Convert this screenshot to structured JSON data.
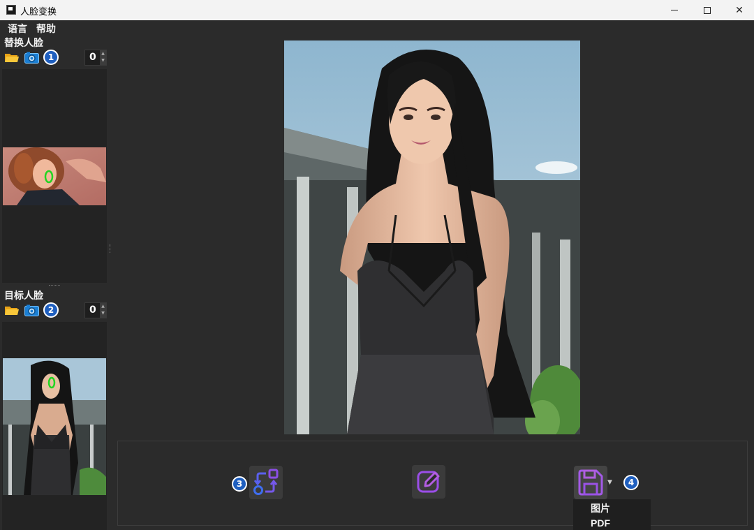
{
  "window": {
    "title": "人脸变换",
    "minimize_icon": "minimize-icon",
    "maximize_icon": "maximize-icon",
    "close_symbol": "✕"
  },
  "menu": {
    "items": [
      "语言",
      "帮助"
    ]
  },
  "source_faces": {
    "title": "替换人脸",
    "badge": "1",
    "count": "0"
  },
  "target_faces": {
    "title": "目标人脸",
    "badge": "2",
    "count": "0"
  },
  "actions": {
    "swap_badge": "3",
    "save_badge": "4",
    "swap_icon": "swap-icon",
    "edit_icon": "edit-icon",
    "save_icon": "save-icon"
  },
  "save_menu": {
    "items": [
      "图片",
      "PDF"
    ]
  },
  "colors": {
    "background": "#2b2b2b",
    "badge": "#1f5fbf",
    "accent_purple": "#a35ce6",
    "accent_blue": "#4a63e8",
    "face_marker": "#21d521"
  }
}
